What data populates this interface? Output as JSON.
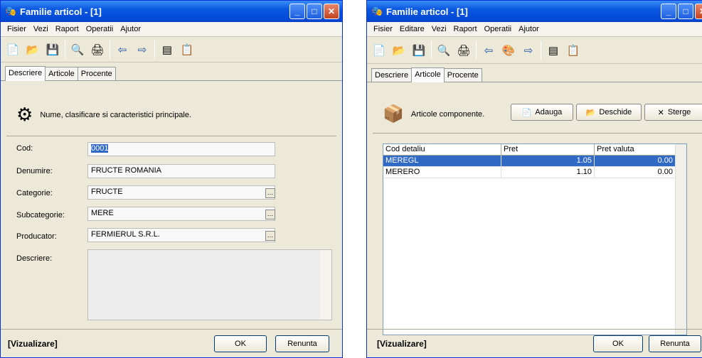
{
  "left": {
    "title": "Familie articol - [1]",
    "menu": [
      "Fisier",
      "Vezi",
      "Raport",
      "Operatii",
      "Ajutor"
    ],
    "tabs": [
      "Descriere",
      "Articole",
      "Procente"
    ],
    "header_text": "Nume, clasificare si caracteristici principale.",
    "fields": {
      "cod_label": "Cod:",
      "cod_value": "0001",
      "denumire_label": "Denumire:",
      "denumire_value": "FRUCTE ROMANIA",
      "categorie_label": "Categorie:",
      "categorie_value": "FRUCTE",
      "subcategorie_label": "Subcategorie:",
      "subcategorie_value": "MERE",
      "producator_label": "Producator:",
      "producator_value": "FERMIERUL S.R.L.",
      "descriere_label": "Descriere:"
    },
    "status": "[Vizualizare]",
    "ok": "OK",
    "cancel": "Renunta"
  },
  "right": {
    "title": "Familie articol - [1]",
    "menu": [
      "Fisier",
      "Editare",
      "Vezi",
      "Raport",
      "Operatii",
      "Ajutor"
    ],
    "tabs": [
      "Descriere",
      "Articole",
      "Procente"
    ],
    "header_text": "Articole componente.",
    "buttons": {
      "add": "Adauga",
      "open": "Deschide",
      "delete": "Sterge"
    },
    "grid": {
      "headers": [
        "Cod detaliu",
        "Pret",
        "Pret valuta"
      ],
      "rows": [
        [
          "MEREGL",
          "1.05",
          "0.00"
        ],
        [
          "MERERO",
          "1.10",
          "0.00"
        ]
      ]
    },
    "status": "[Vizualizare]",
    "ok": "OK",
    "cancel": "Renunta"
  },
  "icons": [
    "new-icon",
    "open-folder-icon",
    "save-icon",
    "preview-icon",
    "print-icon",
    "back-arrow-icon",
    "forward-arrow-icon",
    "form-icon",
    "properties-icon",
    "gear-icon",
    "box-icon"
  ]
}
